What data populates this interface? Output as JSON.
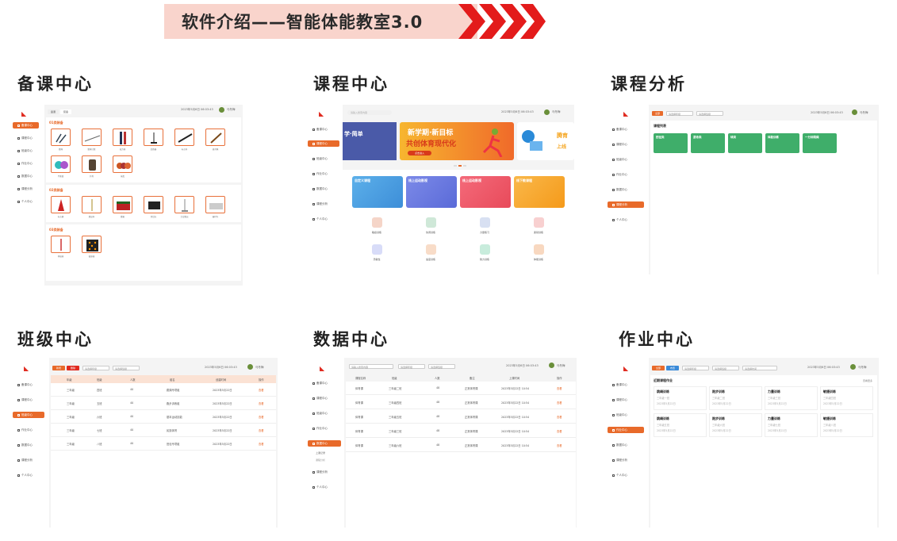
{
  "banner": {
    "title": "软件介绍——智能体能教室3.0"
  },
  "sections": {
    "prep": "备课中心",
    "course": "课程中心",
    "analysis": "课程分析",
    "class": "班级中心",
    "data": "数据中心",
    "homework": "作业中心"
  },
  "nav": [
    "备课中心",
    "课程中心",
    "班级中心",
    "作业中心",
    "数据中心",
    "课程分析",
    "个人中心"
  ],
  "user": {
    "name": "马冬梅",
    "timestamp": "2023年5月6日 06:03:43"
  },
  "prep": {
    "tabs": [
      "备课",
      "装备"
    ],
    "cat1": "01类装备",
    "cat1_items": [
      "跳绳",
      "跳绳计数",
      "接力棒",
      "起跑器",
      "标志杆",
      "拔河绳",
      "平衡盘",
      "护具",
      "球类"
    ],
    "cat2": "02类装备",
    "cat2_items": [
      "标志桶",
      "跳高杆",
      "跳箱",
      "测试仪",
      "立定跳远",
      "器材车"
    ],
    "cat3": "03类装备",
    "cat3_items": [
      "体操棒",
      "敏捷梯"
    ]
  },
  "course": {
    "search_placeholder": "请输入搜索内容",
    "hero1": "新学期·新目标",
    "hero2": "共创体育现代化",
    "hero_btn": "点击进入",
    "hero_side": "上线",
    "hero_left": "学·简单",
    "cards": [
      "自定义课程",
      "线上运动影视",
      "线上运动影视",
      "线下教课程"
    ],
    "icons": [
      "敏捷训练",
      "协调训练",
      "力量练习",
      "柔韧训练",
      "灵敏性",
      "速度训练",
      "耐力训练",
      "体能训练"
    ]
  },
  "analysis": {
    "btn": "全部",
    "filter1": "请选择年级",
    "filter2": "请选择班级",
    "heading": "课程列表",
    "cards": [
      "田径类",
      "游泳类",
      "球类",
      "体能训练",
      "一分钟跳绳"
    ]
  },
  "class": {
    "btn1": "新增",
    "btn2": "删除",
    "filter1": "请选择年级",
    "filter2": "请选择班级",
    "headers": [
      "年级",
      "班级",
      "人数",
      "组名",
      "创建时间",
      "操作"
    ],
    "rows": [
      [
        "三年级",
        "四班",
        "40",
        "跳绳专项组",
        "2023年5月22日",
        "查看"
      ],
      [
        "三年级",
        "五班",
        "40",
        "跑步训练组",
        "2023年5月22日",
        "查看"
      ],
      [
        "三年级",
        "六班",
        "40",
        "基本运动技能",
        "2023年5月22日",
        "查看"
      ],
      [
        "三年级",
        "七班",
        "40",
        "民族体育",
        "2023年5月22日",
        "查看"
      ],
      [
        "三年级",
        "八班",
        "40",
        "田径专项组",
        "2023年5月22日",
        "查看"
      ]
    ]
  },
  "data": {
    "search_placeholder": "请输入搜索内容",
    "filter1": "请选择年级",
    "filter2": "请选择班级",
    "submenu": [
      "上课记录",
      "课程分析"
    ],
    "headers": [
      "课程名称",
      "班级",
      "人数",
      "备注",
      "上课时间",
      "操作"
    ],
    "rows": [
      [
        "体育课",
        "三年级二班",
        "48",
        "正常体育课",
        "2023年5月22日 10:54",
        "查看"
      ],
      [
        "体育课",
        "三年级四班",
        "48",
        "正常体育课",
        "2023年5月22日 10:54",
        "查看"
      ],
      [
        "体育课",
        "三年级五班",
        "48",
        "正常体育课",
        "2023年5月22日 10:54",
        "查看"
      ],
      [
        "体育课",
        "三年级三班",
        "48",
        "正常体育课",
        "2023年5月22日 10:54",
        "查看"
      ],
      [
        "体育课",
        "三年级六班",
        "48",
        "正常体育课",
        "2023年5月22日 10:54",
        "查看"
      ]
    ]
  },
  "homework": {
    "btn1": "全部",
    "btn2": "布置",
    "filter1": "请选择年级",
    "filter2": "请选择班级",
    "filter3": "请选择时间",
    "heading": "近期课程作业",
    "more": "查看更多",
    "cards": [
      {
        "title": "跳绳训练",
        "sub": "三年级一班",
        "date": "2023年5月22日"
      },
      {
        "title": "跑步训练",
        "sub": "三年级二班",
        "date": "2023年5月22日"
      },
      {
        "title": "力量训练",
        "sub": "三年级三班",
        "date": "2023年5月22日"
      },
      {
        "title": "敏捷训练",
        "sub": "三年级四班",
        "date": "2023年5月22日"
      },
      {
        "title": "跳绳训练",
        "sub": "三年级五班",
        "date": "2023年5月22日"
      },
      {
        "title": "跑步训练",
        "sub": "三年级六班",
        "date": "2023年5月22日"
      },
      {
        "title": "力量训练",
        "sub": "三年级七班",
        "date": "2023年5月22日"
      },
      {
        "title": "敏捷训练",
        "sub": "三年级八班",
        "date": "2023年5月22日"
      }
    ]
  }
}
